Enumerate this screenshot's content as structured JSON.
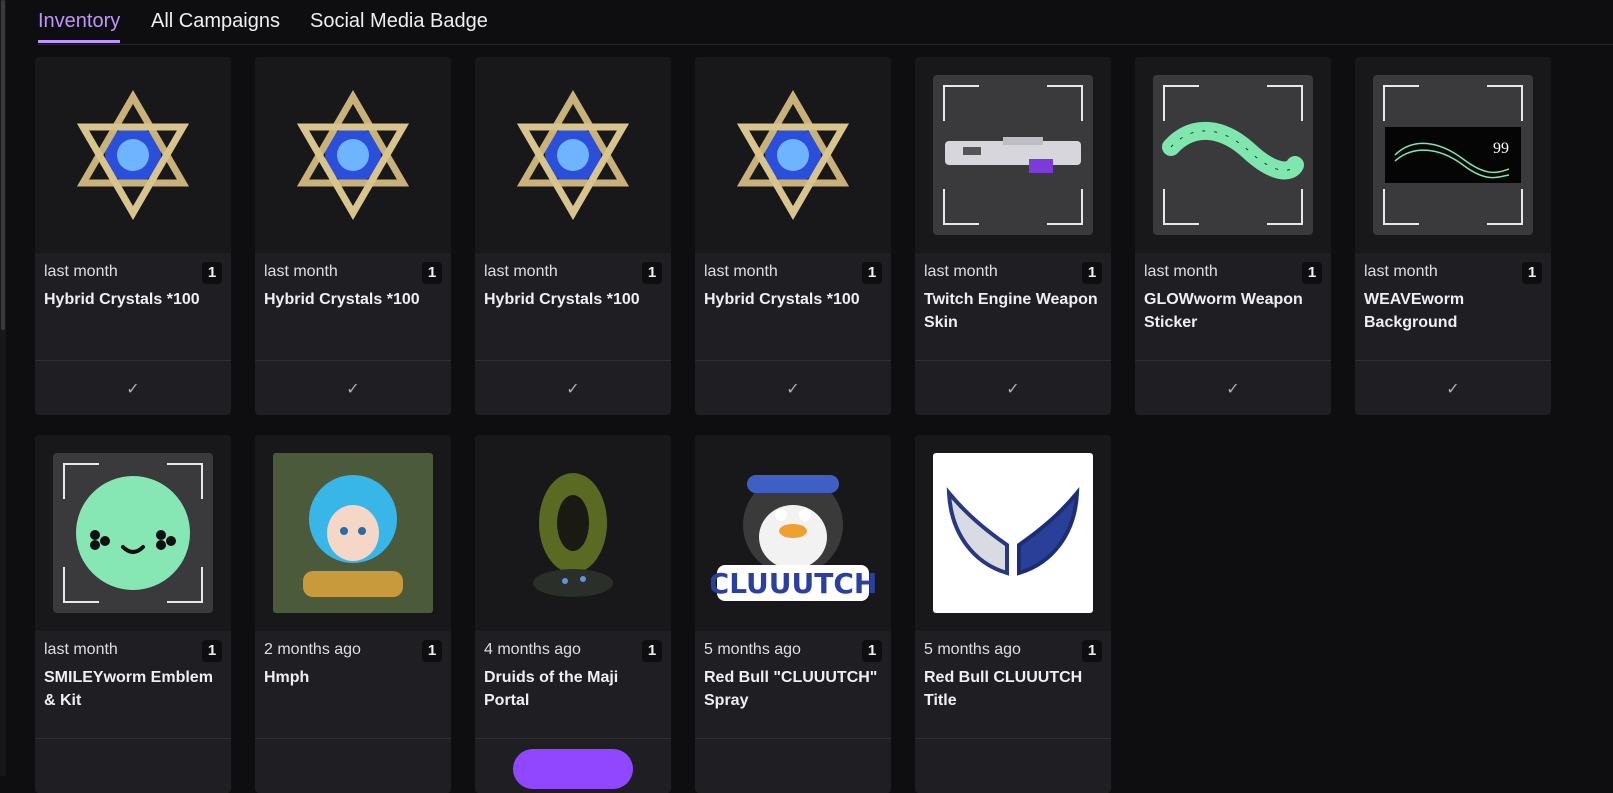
{
  "tabs": [
    {
      "label": "Inventory",
      "active": true
    },
    {
      "label": "All Campaigns",
      "active": false
    },
    {
      "label": "Social Media Badge",
      "active": false
    }
  ],
  "accent_color": "#bf94ff",
  "check_icon": "✓",
  "items": [
    {
      "time": "last month",
      "count": "1",
      "name": "Hybrid Crystals *100",
      "icon": "crystal-star-icon"
    },
    {
      "time": "last month",
      "count": "1",
      "name": "Hybrid Crystals *100",
      "icon": "crystal-star-icon"
    },
    {
      "time": "last month",
      "count": "1",
      "name": "Hybrid Crystals *100",
      "icon": "crystal-star-icon"
    },
    {
      "time": "last month",
      "count": "1",
      "name": "Hybrid Crystals *100",
      "icon": "crystal-star-icon"
    },
    {
      "time": "last month",
      "count": "1",
      "name": "Twitch Engine Weapon Skin",
      "icon": "weapon-skin-icon"
    },
    {
      "time": "last month",
      "count": "1",
      "name": "GLOWworm Weapon Sticker",
      "icon": "glowworm-icon"
    },
    {
      "time": "last month",
      "count": "1",
      "name": "WEAVEworm Background",
      "icon": "weaveworm-icon",
      "art_text": "99"
    },
    {
      "time": "last month",
      "count": "1",
      "name": "SMILEYworm Emblem & Kit",
      "icon": "smiley-icon"
    },
    {
      "time": "2 months ago",
      "count": "1",
      "name": "Hmph",
      "icon": "character-portrait-icon"
    },
    {
      "time": "4 months ago",
      "count": "1",
      "name": "Druids of the Maji Portal",
      "icon": "portal-icon"
    },
    {
      "time": "5 months ago",
      "count": "1",
      "name": "Red Bull \"CLUUUTCH\" Spray",
      "icon": "penguin-spray-icon",
      "art_text": "CLUUUTCH"
    },
    {
      "time": "5 months ago",
      "count": "1",
      "name": "Red Bull CLUUUTCH Title",
      "icon": "wings-icon"
    }
  ]
}
